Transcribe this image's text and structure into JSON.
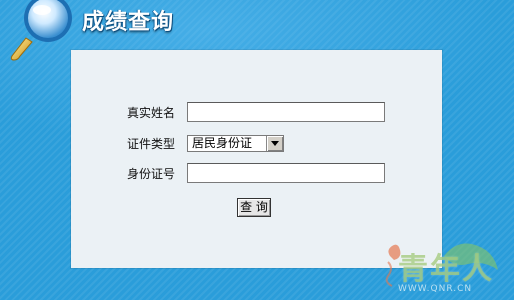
{
  "header": {
    "title": "成绩查询"
  },
  "form": {
    "name_label": "真实姓名",
    "name_value": "",
    "id_type_label": "证件类型",
    "id_type_selected": "居民身份证",
    "id_number_label": "身份证号",
    "id_number_value": "",
    "submit_label": "查 询"
  },
  "watermark": {
    "text": "青年人",
    "url": "WWW.QNR.CN"
  },
  "colors": {
    "background": "#2a9dda",
    "panel": "#ebf1f5"
  }
}
